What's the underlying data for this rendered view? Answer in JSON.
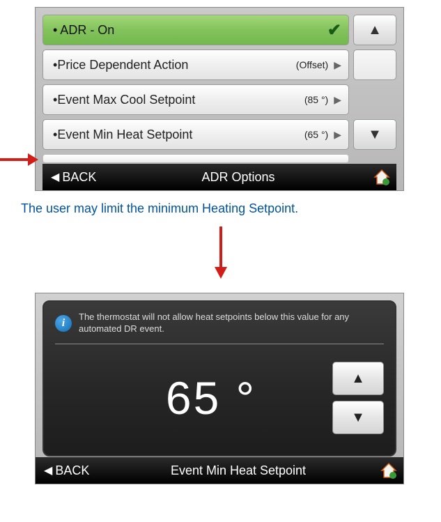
{
  "screen1": {
    "items": [
      {
        "label": "ADR - On",
        "value": "",
        "active": true,
        "hasCheck": true
      },
      {
        "label": "Price Dependent Action",
        "value": "(Offset)",
        "active": false,
        "hasCheck": false
      },
      {
        "label": "Event Max Cool Setpoint",
        "value": "(85 °)",
        "active": false,
        "hasCheck": false
      },
      {
        "label": "Event Min Heat Setpoint",
        "value": "(65 °)",
        "active": false,
        "hasCheck": false
      }
    ],
    "back": "BACK",
    "title": "ADR Options"
  },
  "caption": "The user may limit the minimum Heating Setpoint.",
  "screen2": {
    "info": "The thermostat will not allow heat setpoints below this value for any automated DR event.",
    "value": "65 °",
    "back": "BACK",
    "title": "Event Min Heat Setpoint"
  }
}
